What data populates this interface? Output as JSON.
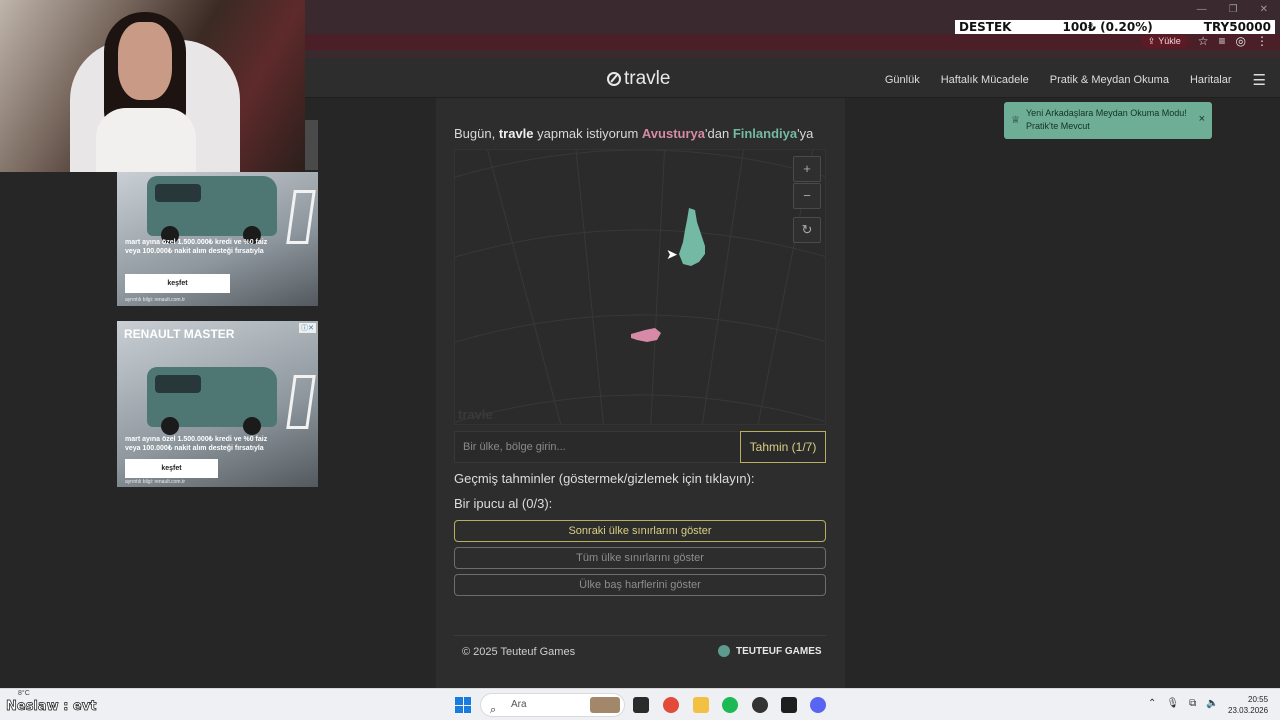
{
  "browser": {
    "ticker_left": "DESTEK",
    "ticker_mid": "100₺ (0.20%)",
    "ticker_right": "TRY50000",
    "yukle_label": "Yükle"
  },
  "nav": {
    "logo": "travle",
    "links": [
      "Günlük",
      "Haftalık Mücadele",
      "Pratik & Meydan Okuma",
      "Haritalar"
    ]
  },
  "ads": {
    "ad1": {
      "text": "mart ayına özel 1.500.000₺ kredi ve %0 faiz veya 100.000₺ nakit alım desteği fırsatıyla",
      "button": "keşfet",
      "small": "ayrıntılı bilgi: renault.com.tr"
    },
    "ad2": {
      "title": "RENAULT MASTER",
      "text": "mart ayına özel 1.500.000₺ kredi ve %0 faiz veya 100.000₺ nakit alım desteği fırsatıyla",
      "button": "keşfet",
      "small": "ayrıntılı bilgi: renault.com.tr"
    }
  },
  "game": {
    "prompt_prefix": "Bugün, ",
    "prompt_brand": "travle",
    "prompt_mid": " yapmak istiyorum ",
    "from_country": "Avusturya",
    "from_suffix": "'dan ",
    "to_country": "Finlandiya",
    "to_suffix": "'ya",
    "map_zoom_in": "+",
    "map_zoom_out": "−",
    "map_reset": "↻",
    "map_watermark": "travle",
    "input_placeholder": "Bir ülke, bölge girin...",
    "guess_button": "Tahmin (1/7)",
    "history_label": "Geçmiş tahminler (göstermek/gizlemek için tıklayın):",
    "hint_title": "Bir ipucu al (0/3):",
    "hints": [
      "Sonraki ülke sınırlarını göster",
      "Tüm ülke sınırlarını göster",
      "Ülke baş harflerini göster"
    ],
    "colors": {
      "from": "#d68aa6",
      "to": "#74b9a4",
      "accent": "#b9ad5e"
    }
  },
  "footer": {
    "copyright": "© 2025 Teuteuf Games",
    "brand": "TEUTEUF GAMES"
  },
  "toast": {
    "text": "Yeni Arkadaşlara Meydan Okuma Modu! Pratik'te Mevcut",
    "close": "×"
  },
  "taskbar": {
    "temp": "8°C",
    "overlay_text": "Neslaw : evt",
    "search_placeholder": "Ara",
    "time": "20:55",
    "date": "23.03.2026"
  }
}
